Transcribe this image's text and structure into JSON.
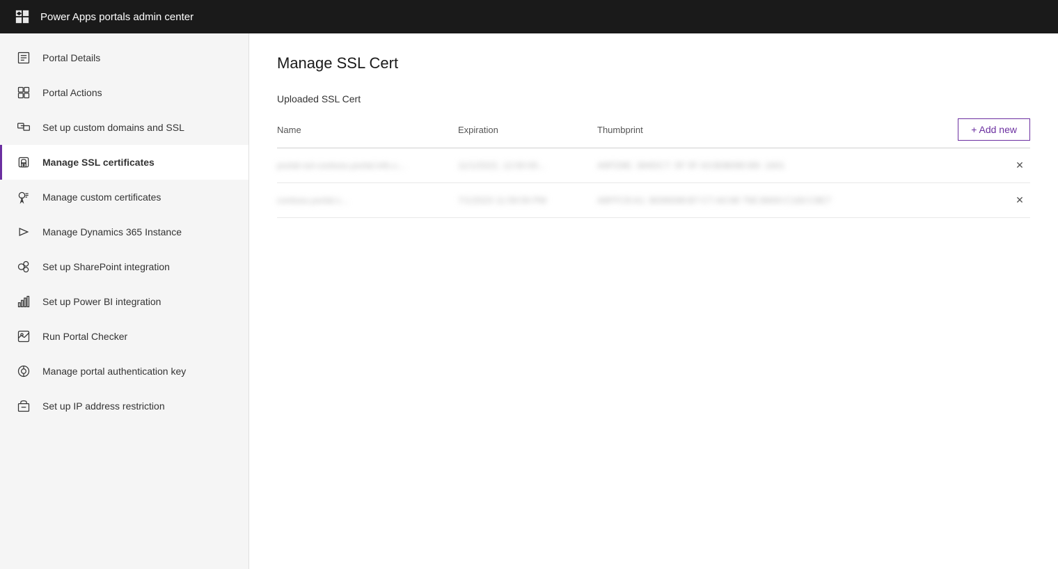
{
  "topbar": {
    "title": "Power Apps portals admin center"
  },
  "sidebar": {
    "items": [
      {
        "id": "portal-details",
        "label": "Portal Details",
        "icon": "list-icon",
        "active": false
      },
      {
        "id": "portal-actions",
        "label": "Portal Actions",
        "icon": "actions-icon",
        "active": false
      },
      {
        "id": "custom-domains",
        "label": "Set up custom domains and SSL",
        "icon": "domains-icon",
        "active": false
      },
      {
        "id": "manage-ssl",
        "label": "Manage SSL certificates",
        "icon": "ssl-icon",
        "active": true
      },
      {
        "id": "manage-custom-certs",
        "label": "Manage custom certificates",
        "icon": "cert-icon",
        "active": false
      },
      {
        "id": "dynamics-instance",
        "label": "Manage Dynamics 365 Instance",
        "icon": "dynamics-icon",
        "active": false
      },
      {
        "id": "sharepoint",
        "label": "Set up SharePoint integration",
        "icon": "sharepoint-icon",
        "active": false
      },
      {
        "id": "powerbi",
        "label": "Set up Power BI integration",
        "icon": "powerbi-icon",
        "active": false
      },
      {
        "id": "portal-checker",
        "label": "Run Portal Checker",
        "icon": "checker-icon",
        "active": false
      },
      {
        "id": "auth-key",
        "label": "Manage portal authentication key",
        "icon": "auth-icon",
        "active": false
      },
      {
        "id": "ip-restriction",
        "label": "Set up IP address restriction",
        "icon": "ip-icon",
        "active": false
      }
    ]
  },
  "main": {
    "page_title": "Manage SSL Cert",
    "section_title": "Uploaded SSL Cert",
    "add_new_label": "+ Add new",
    "table": {
      "columns": [
        "Name",
        "Expiration",
        "Thumbprint"
      ],
      "rows": [
        {
          "name": "portal-ssl-contoso.portal.info.c...",
          "expiration": "11/1/2022, 12:00:00...",
          "thumbprint": "A9FD9E: 384DC7: 5F 5F A3:B0B080:B9: 1601"
        },
        {
          "name": "contoso.portal.c...",
          "expiration": "7/1/2023 11:59:59 PM",
          "thumbprint": "A8FFC8:A1: B099098:B7:C7:A0:98 76E:B900:C160:C8E7"
        }
      ]
    }
  }
}
